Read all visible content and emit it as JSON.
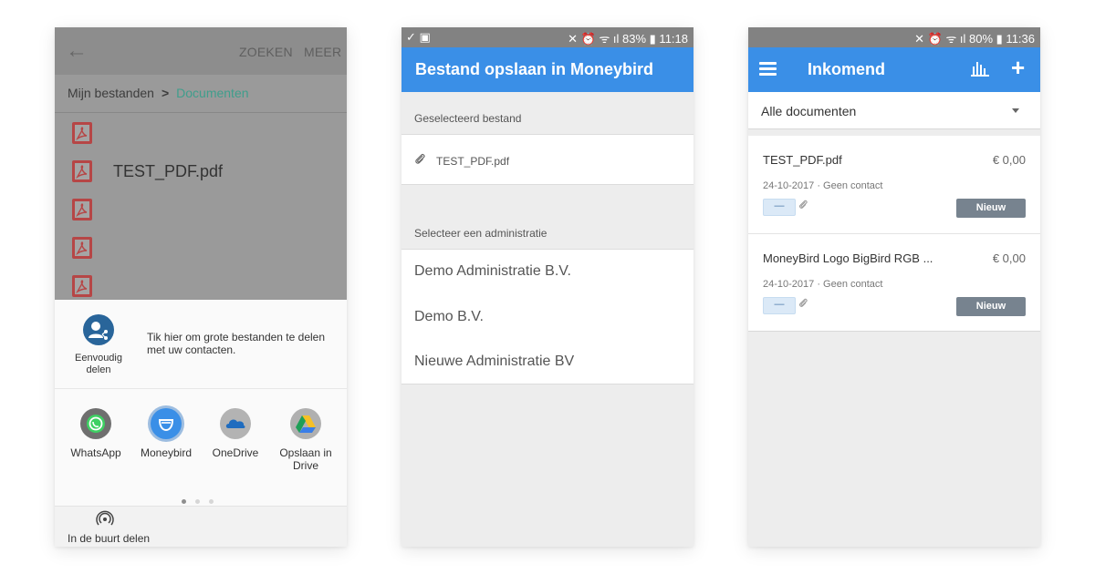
{
  "phone1": {
    "toolbar": {
      "search_label": "ZOEKEN",
      "more_label": "MEER",
      "back_icon": "arrow-left-icon"
    },
    "breadcrumb": {
      "root": "Mijn bestanden",
      "separator": ">",
      "current": "Documenten"
    },
    "files": {
      "visible_name": "TEST_PDF.pdf",
      "icon": "pdf-icon"
    },
    "share_sheet": {
      "easy_share_label": "Eenvoudig delen",
      "easy_share_hint": "Tik hier om grote bestanden te delen met uw contacten.",
      "apps": [
        {
          "label": "WhatsApp",
          "icon": "whatsapp-icon",
          "color": "#6f6f6f"
        },
        {
          "label": "Moneybird",
          "icon": "moneybird-icon",
          "color": "#3a8fe7"
        },
        {
          "label": "OneDrive",
          "icon": "onedrive-icon",
          "color": "#5a8fc7"
        },
        {
          "label": "Opslaan in Drive",
          "icon": "google-drive-icon",
          "color": "#b0b0b0"
        }
      ],
      "page_indicator": {
        "pages": 3,
        "active": 1
      },
      "nearby_label": "In de buurt delen"
    }
  },
  "phone2": {
    "status": {
      "left": "✓ ▣",
      "right": "✕ ⏰ ᯤ ıl 83% ▮ 11:18"
    },
    "title": "Bestand opslaan in Moneybird",
    "selected_file_label": "Geselecteerd bestand",
    "selected_file_name": "TEST_PDF.pdf",
    "administration_label": "Selecteer een administratie",
    "administrations": [
      "Demo Administratie B.V.",
      "Demo B.V.",
      "Nieuwe Administratie BV"
    ]
  },
  "phone3": {
    "status": {
      "right": "✕ ⏰ ᯤ ıl 80% ▮ 11:36"
    },
    "title": "Inkomend",
    "filter_value": "Alle documenten",
    "documents": [
      {
        "name": "TEST_PDF.pdf",
        "amount": "€ 0,00",
        "meta": "24-10-2017 · Geen contact",
        "tag": "—",
        "status": "Nieuw"
      },
      {
        "name": "MoneyBird Logo BigBird RGB ...",
        "amount": "€ 0,00",
        "meta": "24-10-2017 · Geen contact",
        "tag": "—",
        "status": "Nieuw"
      }
    ],
    "accent_color": "#3a8fe7"
  }
}
